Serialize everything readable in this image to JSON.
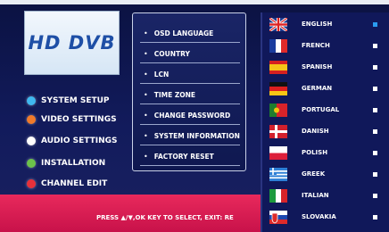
{
  "logo": {
    "text": "HD DVB"
  },
  "main_menu": [
    {
      "label": "SYSTEM SETUP",
      "color": "#3fb8ef"
    },
    {
      "label": "VIDEO SETTINGS",
      "color": "#f07a2a"
    },
    {
      "label": "AUDIO SETTINGS",
      "color": "#ffffff"
    },
    {
      "label": "INSTALLATION",
      "color": "#6cc24a"
    },
    {
      "label": "CHANNEL EDIT",
      "color": "#e8303a"
    }
  ],
  "submenu": [
    {
      "label": "OSD LANGUAGE"
    },
    {
      "label": "COUNTRY"
    },
    {
      "label": "LCN"
    },
    {
      "label": "TIME ZONE"
    },
    {
      "label": "CHANGE PASSWORD"
    },
    {
      "label": "SYSTEM INFORMATION"
    },
    {
      "label": "FACTORY RESET"
    }
  ],
  "languages": [
    {
      "name": "ENGLISH",
      "flag": "uk-flag-icon",
      "selected": true
    },
    {
      "name": "FRENCH",
      "flag": "france-flag-icon",
      "selected": false
    },
    {
      "name": "SPANISH",
      "flag": "spain-flag-icon",
      "selected": false
    },
    {
      "name": "GERMAN",
      "flag": "germany-flag-icon",
      "selected": false
    },
    {
      "name": "PORTUGAL",
      "flag": "portugal-flag-icon",
      "selected": false
    },
    {
      "name": "DANISH",
      "flag": "denmark-flag-icon",
      "selected": false
    },
    {
      "name": "POLISH",
      "flag": "poland-flag-icon",
      "selected": false
    },
    {
      "name": "GREEK",
      "flag": "greece-flag-icon",
      "selected": false
    },
    {
      "name": "ITALIAN",
      "flag": "italy-flag-icon",
      "selected": false
    },
    {
      "name": "SLOVAKIA",
      "flag": "slovakia-flag-icon",
      "selected": false
    }
  ],
  "hint": "PRESS ▲/▼,OK KEY TO SELECT, EXIT: RE"
}
